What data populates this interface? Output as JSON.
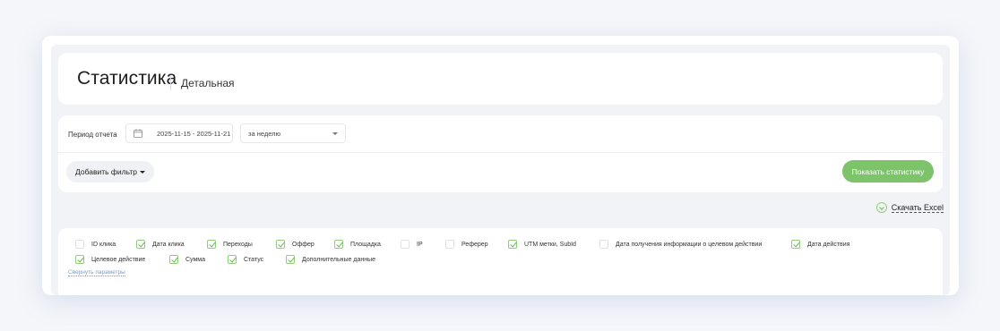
{
  "header": {
    "title": "Статистика",
    "subtitle": "Детальная"
  },
  "filters": {
    "period_label": "Период отчета",
    "date_range": "2025-11-15 - 2025-11-21",
    "period_select": "за неделю",
    "add_filter_label": "Добавить фильтр",
    "show_stats_label": "Показать статистику"
  },
  "export": {
    "excel_label": "Скачать Excel"
  },
  "params": {
    "items": [
      {
        "label": "ID клика",
        "checked": false
      },
      {
        "label": "Дата клика",
        "checked": true
      },
      {
        "label": "Переходы",
        "checked": true
      },
      {
        "label": "Оффер",
        "checked": true
      },
      {
        "label": "Площадка",
        "checked": true
      },
      {
        "label": "IP",
        "checked": false
      },
      {
        "label": "Реферер",
        "checked": false
      },
      {
        "label": "UTM метки, SubId",
        "checked": true
      },
      {
        "label": "Дата получения информации о целевом действии",
        "checked": false
      },
      {
        "label": "Дата действия",
        "checked": true
      },
      {
        "label": "Целевое действие",
        "checked": true
      },
      {
        "label": "Сумма",
        "checked": true
      },
      {
        "label": "Статус",
        "checked": true
      },
      {
        "label": "Дополнительные данные",
        "checked": true
      }
    ],
    "collapse_label": "Свернуть параметры"
  },
  "colors": {
    "accent_green": "#7cc36a",
    "background": "#f2f3f6",
    "link": "#7a9cc6"
  },
  "icons": [
    "calendar-icon",
    "chevron-down-icon",
    "download-icon",
    "checkbox-icon"
  ]
}
